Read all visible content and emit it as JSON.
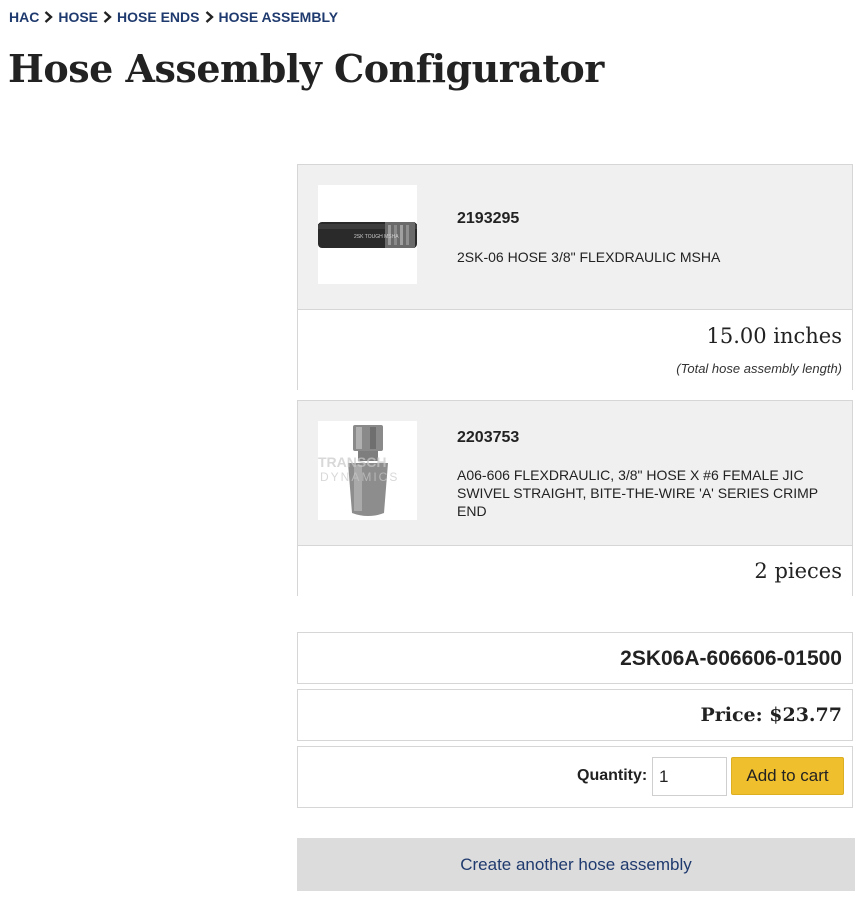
{
  "breadcrumb": {
    "items": [
      {
        "label": "HAC"
      },
      {
        "label": "HOSE"
      },
      {
        "label": "HOSE ENDS"
      },
      {
        "label": "HOSE ASSEMBLY"
      }
    ]
  },
  "page_title": "Hose Assembly Configurator",
  "hose": {
    "part_number": "2193295",
    "description": "2SK-06 HOSE 3/8\" FLEXDRAULIC MSHA",
    "image_label": "2SK TOUGH MSHA",
    "length": "15.00 inches",
    "length_note": "(Total hose assembly length)"
  },
  "fitting": {
    "part_number": "2203753",
    "description": "A06-606 FLEXDRAULIC, 3/8\" HOSE X #6 FEMALE JIC SWIVEL STRAIGHT, BITE-THE-WIRE 'A' SERIES CRIMP END",
    "watermark_line1": "TRANSCH",
    "watermark_line2": "DYNAMICS",
    "quantity": "2 pieces"
  },
  "assembly_code": "2SK06A-606606-01500",
  "price": {
    "label": "Price: $23.77"
  },
  "cart": {
    "quantity_label": "Quantity:",
    "quantity_value": "1",
    "add_label": "Add to cart"
  },
  "create_another_label": "Create another hose assembly",
  "colors": {
    "link": "#1f3a6e",
    "button_yellow": "#f0bf2d",
    "panel_gray": "#f0f0f0"
  }
}
